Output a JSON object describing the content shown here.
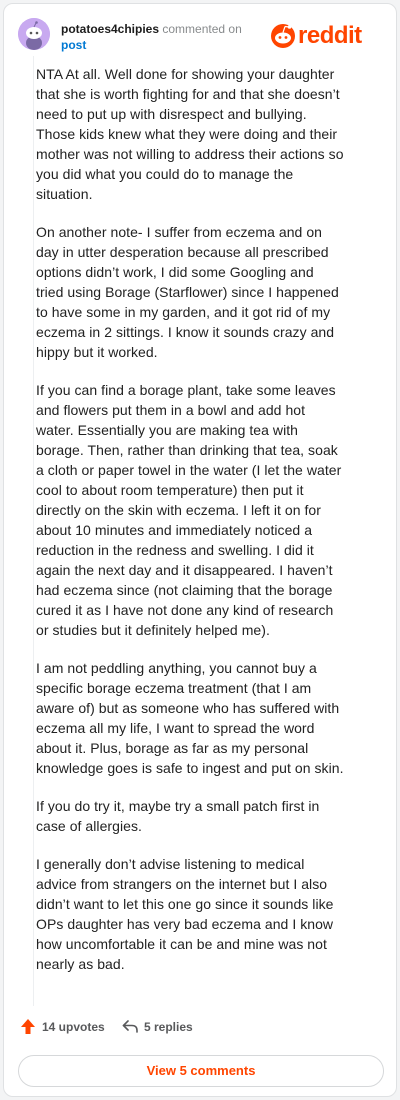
{
  "header": {
    "username": "potatoes4chipies",
    "action_text": "commented on",
    "post_link": "post",
    "brand": "reddit"
  },
  "comment": {
    "paragraphs": [
      "NTA At all. Well done for showing your daughter that she is worth fighting for and that she doesn’t need to put up with disrespect and bullying. Those kids knew what they were doing and their mother was not willing to address their actions so you did what you could do to manage the situation.",
      "On another note- I suffer from eczema and on day in utter desperation because all prescribed options didn’t work, I did some Googling and tried using Borage (Starflower) since I happened to have some in my garden, and it got rid of my eczema in 2 sittings. I know it sounds crazy and hippy but it worked.",
      "If you can find a borage plant, take some leaves and flowers put them in a bowl and add hot water. Essentially you are making tea with borage. Then, rather than drinking that tea, soak a cloth or paper towel in the water (I let the water cool to about room temperature) then put it directly on the skin with eczema. I left it on for about 10 minutes and immediately noticed a reduction in the redness and swelling. I did it again the next day and it disappeared. I haven’t had eczema since (not claiming that the borage cured it as I have not done any kind of research or studies but it definitely helped me).",
      "I am not peddling anything, you cannot buy a specific borage eczema treatment (that I am aware of) but as someone who has suffered with eczema all my life, I want to spread the word about it. Plus, borage as far as my personal knowledge goes is safe to ingest and put on skin.",
      "If you do try it, maybe try a small patch first in case of allergies.",
      "I generally don’t advise listening to medical advice from strangers on the internet but I also didn’t want to let this one go since it sounds like OPs daughter has very bad eczema and I know how uncomfortable it can be and mine was not nearly as bad."
    ]
  },
  "actions": {
    "upvotes": "14 upvotes",
    "replies": "5 replies"
  },
  "footer": {
    "view_comments": "View 5 comments"
  },
  "colors": {
    "brand": "#ff4500",
    "link": "#0079d3",
    "avatar": "#c8a9f0"
  },
  "icons": {
    "avatar": "snoo-avatar-icon",
    "logo": "reddit-alien-icon",
    "upvote": "upvote-arrow-icon",
    "reply": "reply-arrow-icon"
  }
}
